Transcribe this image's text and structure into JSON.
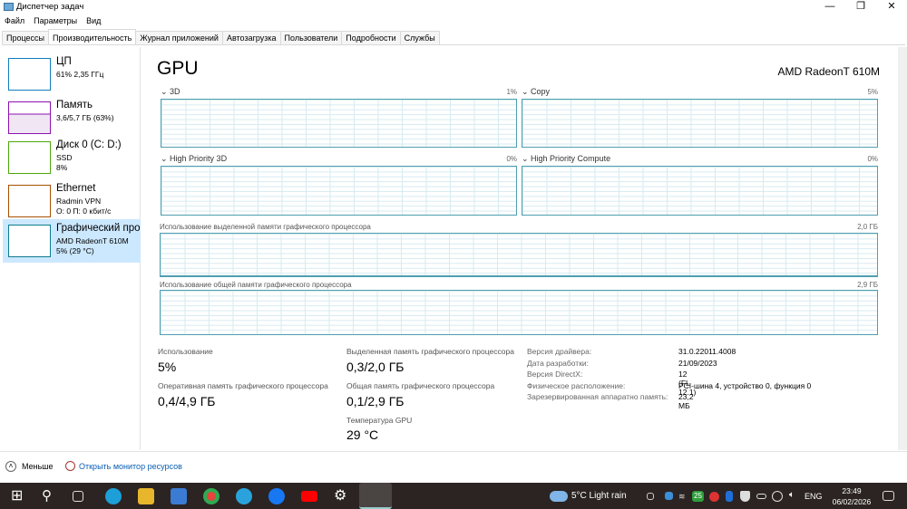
{
  "window": {
    "title": "Диспетчер задач",
    "minimize": "—",
    "maximize": "❐",
    "close": "✕"
  },
  "menu": [
    "Файл",
    "Параметры",
    "Вид"
  ],
  "tabs": [
    "Процессы",
    "Производительность",
    "Журнал приложений",
    "Автозагрузка",
    "Пользователи",
    "Подробности",
    "Службы"
  ],
  "sidebar": [
    {
      "name": "ЦП",
      "s1": "61% 2,35 ГГц",
      "s2": "",
      "color": "#117dbb"
    },
    {
      "name": "Память",
      "s1": "3,6/5,7 ГБ (63%)",
      "s2": "",
      "color": "#8b12ae"
    },
    {
      "name": "Диск 0 (C: D:)",
      "s1": "SSD",
      "s2": "8%",
      "color": "#4da60c"
    },
    {
      "name": "Ethernet",
      "s1": "Radmin VPN",
      "s2": "О: 0 П: 0 кбит/с",
      "color": "#a74f01"
    },
    {
      "name": "Графический про",
      "s1": "AMD RadeonT 610M",
      "s2": "5% (29 °C)",
      "color": "#0e7c8c"
    }
  ],
  "main": {
    "title": "GPU",
    "device": "AMD RadeonT 610M",
    "engines": [
      {
        "name": "3D",
        "pct": "1%"
      },
      {
        "name": "Copy",
        "pct": "5%"
      },
      {
        "name": "High Priority 3D",
        "pct": "0%"
      },
      {
        "name": "High Priority Compute",
        "pct": "0%"
      }
    ],
    "dedicated_label": "Использование выделенной памяти графического процессора",
    "dedicated_max": "2,0 ГБ",
    "shared_label": "Использование общей памяти графического процессора",
    "shared_max": "2,9 ГБ",
    "stats": {
      "usage_l": "Использование",
      "usage_v": "5%",
      "ram_l": "Оперативная память графического процессора",
      "ram_v": "0,4/4,9 ГБ",
      "ded_l": "Выделенная память графического процессора",
      "ded_v": "0,3/2,0 ГБ",
      "sh_l": "Общая память графического процессора",
      "sh_v": "0,1/2,9 ГБ",
      "temp_l": "Температура GPU",
      "temp_v": "29 °C"
    },
    "details": [
      [
        "Версия драйвера:",
        "31.0.22011.4008"
      ],
      [
        "Дата разработки:",
        "21/09/2023"
      ],
      [
        "Версия DirectX:",
        "12 (FL 12.1)"
      ],
      [
        "Физическое расположение:",
        "PCI-шина 4, устройство 0, функция 0"
      ],
      [
        "Зарезервированная аппаратно память:",
        "23,2 МБ"
      ]
    ]
  },
  "footer": {
    "less": "Меньше",
    "monitor": "Открыть монитор ресурсов"
  },
  "taskbar": {
    "weather": "5°C  Light rain",
    "badge": "25",
    "lang": "ENG",
    "time": "23:49",
    "date": "06/02/2026"
  }
}
